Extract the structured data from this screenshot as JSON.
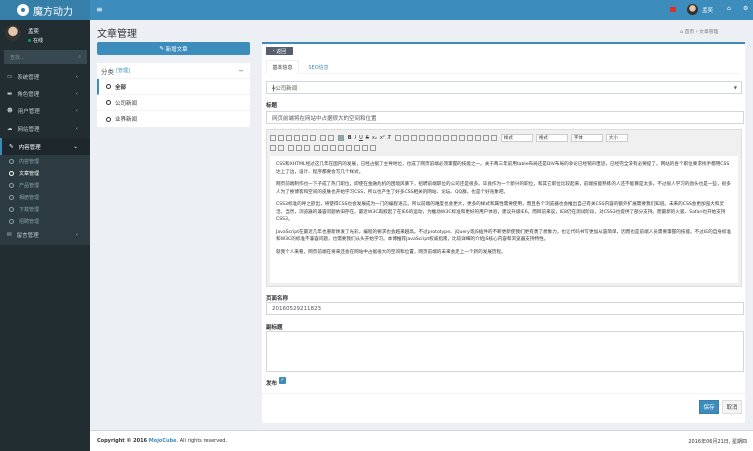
{
  "app": {
    "logo_text": "魔方动力"
  },
  "header": {
    "user_name": "孟奕"
  },
  "sidebar": {
    "user_name": "孟奕",
    "status": "在线",
    "search_placeholder": "查找...",
    "items": [
      {
        "label": "系统管理"
      },
      {
        "label": "角色管理"
      },
      {
        "label": "用户管理"
      },
      {
        "label": "网站管理"
      },
      {
        "label": "内容管理"
      }
    ],
    "subitems": [
      {
        "label": "内容管理"
      },
      {
        "label": "文章管理"
      },
      {
        "label": "产品管理"
      },
      {
        "label": "相册管理"
      },
      {
        "label": "下载管理"
      },
      {
        "label": "招聘管理"
      }
    ],
    "last_item": {
      "label": "留言管理"
    }
  },
  "page": {
    "title": "文章管理",
    "breadcrumb_home": "首页",
    "breadcrumb_current": "文章管理"
  },
  "left": {
    "new_article": "新增文章",
    "category_title": "分类",
    "category_manage": "[管理]",
    "categories": [
      {
        "label": "全部"
      },
      {
        "label": "公司新闻"
      },
      {
        "label": "业界新闻"
      }
    ]
  },
  "form": {
    "back": "返回",
    "tabs": [
      {
        "label": "基本信息"
      },
      {
        "label": "SEO信息"
      }
    ],
    "category_value": "╋公司新闻",
    "title_label": "标题",
    "title_value": "网页前端将在网站中占据很大的空间和位置",
    "toolbar_combos": [
      "样式",
      "格式",
      "字体",
      "大小"
    ],
    "paragraphs": [
      "CSS和XHTML经过这几年在国内的发展，已经占据了主导地位，也成了网页前端必须掌握的技能之一。关于两三年前用table布局还是DIV布局的争论已经销声匿迹，已经完全没有必要提了。网站的各个职位要求找手都用CSS达上了边，设计、程序都要会写几个样式。",
      "网页前端制作也一下子成了热门职位，即使在金融危机的困境风暴下，招聘前端职位的公司还是很多。毕竟作为一个新兴的职位，和其它职位比较起来，前端技能熟练的人还不能算是太多。不过很人学习的劲头也是一些，很多人为了换博客和空间的皮肤也开始学习CSS，所以也产生了好多CSS相关的网站、论坛、QQ群，也是个好兆象吧。",
      "CSS3标准的呼之欲出，将使得CSS也会发展成为一门的编程语言。所以前端的难度也会更大，更多的样式和属性需要使用，而且各个浏览器也会推出自己有关CSS内容的额外扩展需要我们知道。未来的CSS会更加强大和灵活。当然，浏览器的兼容问题依旧存在。最近W3C再掀起了在IE6的运动，为推动W3C标准和更好的用户体验，建议升级IE6。而目前来说，IE8仍在测试阶段，对CSS3也提供了部分支持。而最新的火狐、Safari也开始支持CSS3。",
      "JavaScript在最近几年也重新焕发了光彩，编程的要求也会越来越高。不过prototype、jQuery等JS插件的不断更新使我们更有勇了想象力，也让代码书写更加从容简单，因而也是前端人员需要掌握的技能。不过IE的自身标准和W3C的标准不兼容问题，也需要我们从头开始学习。本博推荐JavaScript权威指南，比较详细的介绍JS核心内容和浏览器支持特性。",
      "就我个人来看，网页前端在将来还会在网站中占据很大的空间和位置，网页前端的未来会走上一个新的发展历程。"
    ],
    "page_name_label": "页面名称",
    "page_name_value": "20160529211823",
    "subtitle_label": "副标题",
    "subtitle_value": "",
    "publish_label": "发布",
    "publish_checked": true,
    "save": "保存",
    "cancel": "取消"
  },
  "footer": {
    "copyright_prefix": "Copyright © 2016 ",
    "brand": "MojoCube",
    "copyright_suffix": ". All rights reserved.",
    "date": "2016年06月21日, 星期四"
  }
}
